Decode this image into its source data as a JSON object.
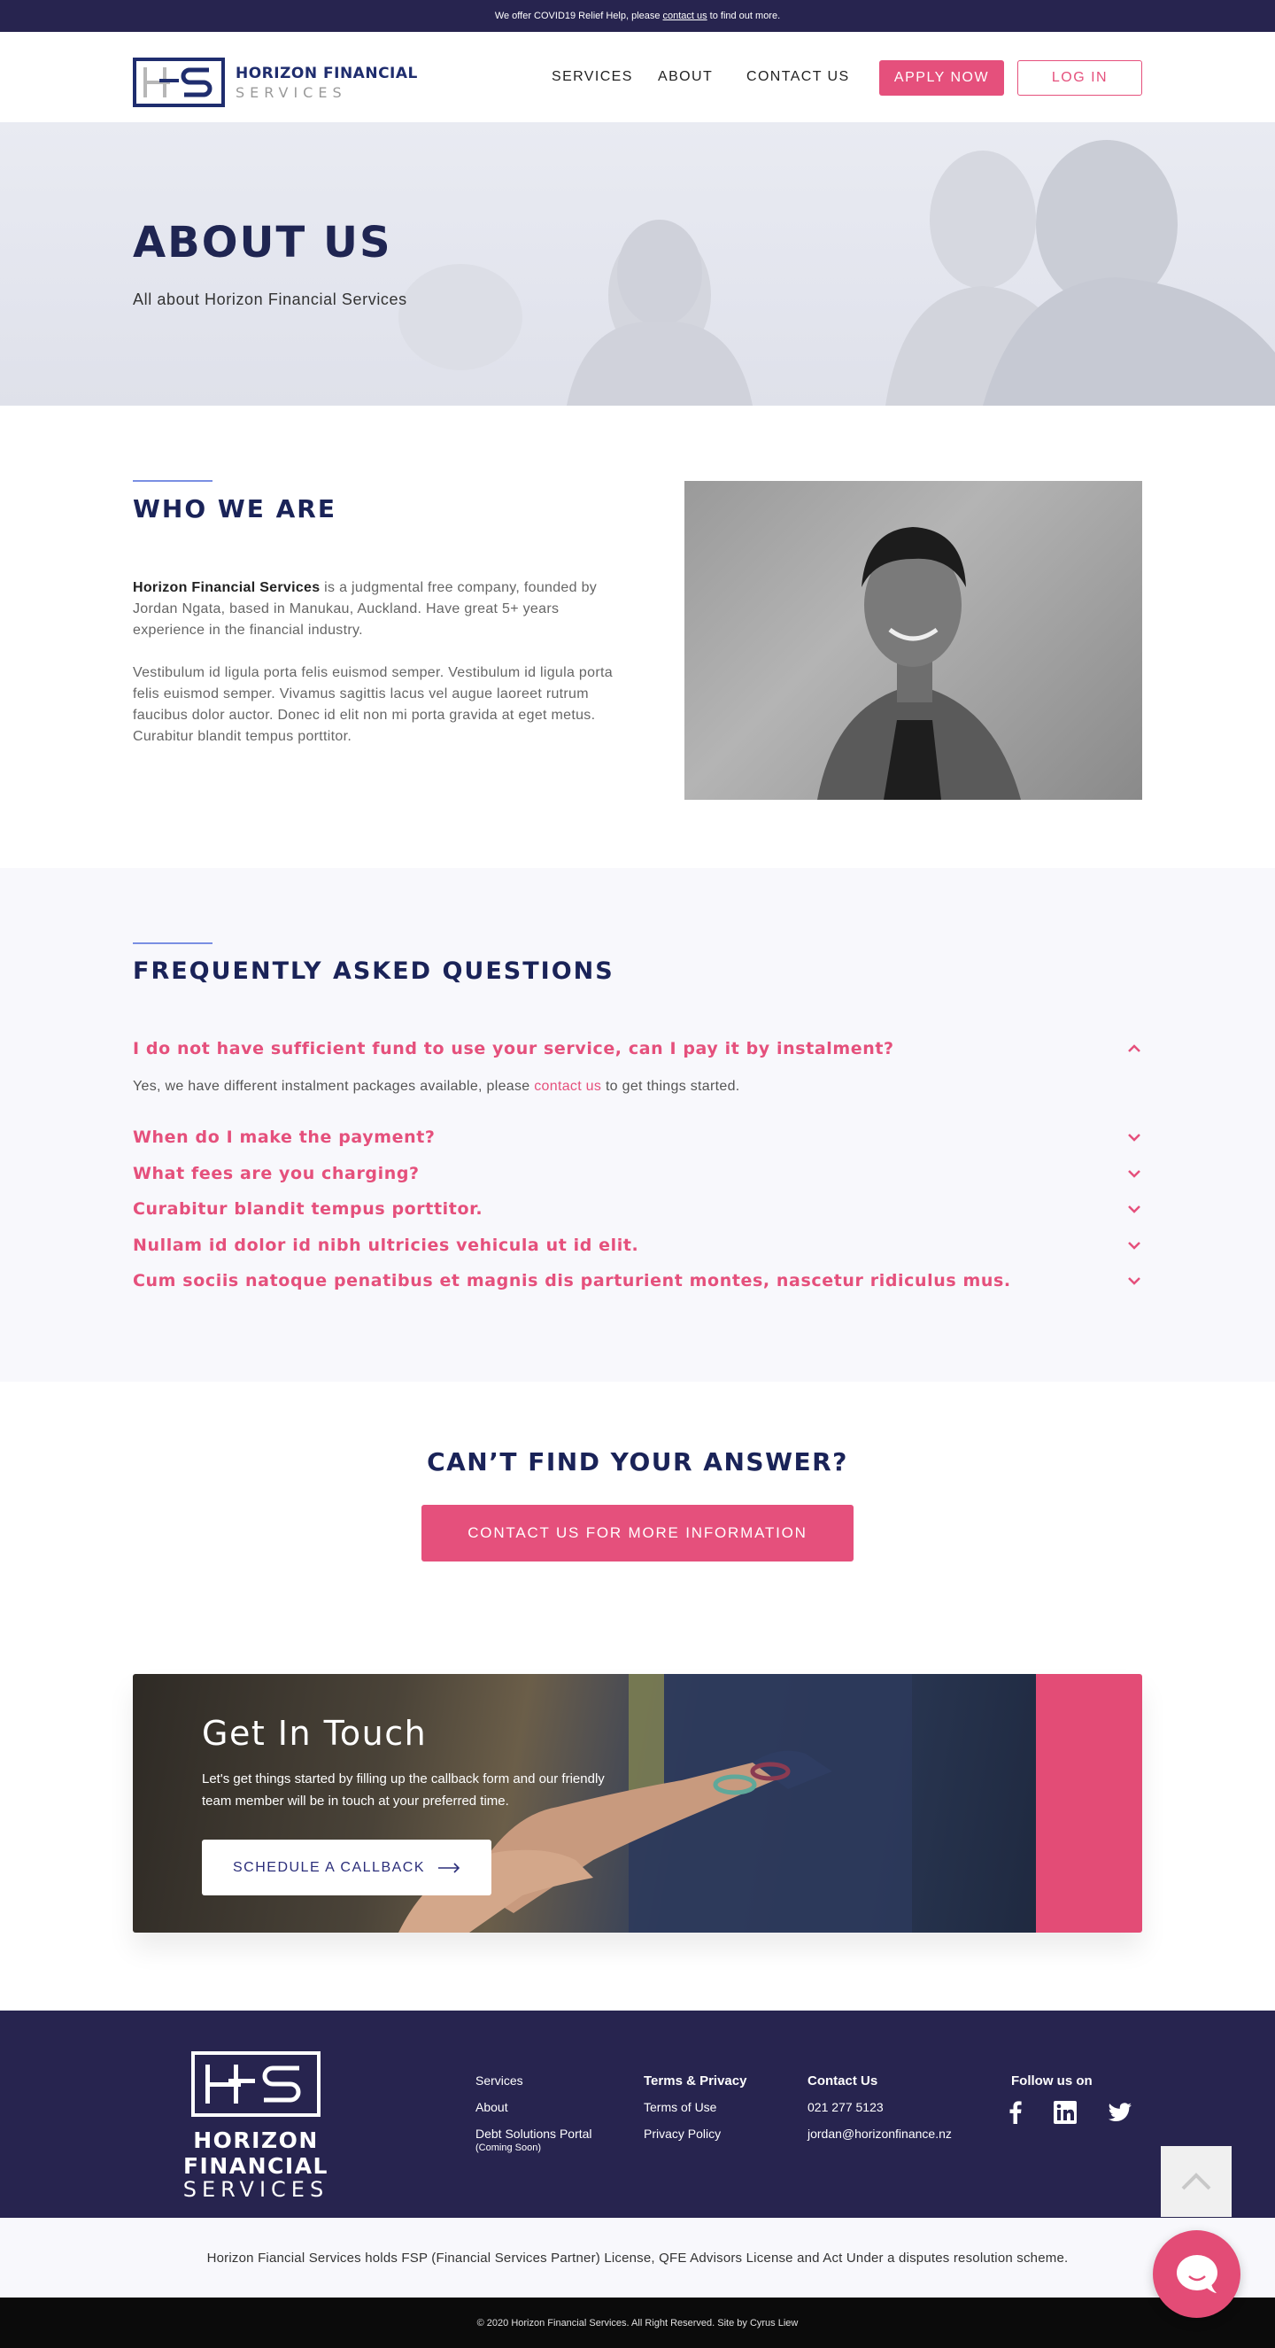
{
  "topbar": {
    "prefix": "We offer COVID19 Relief Help, please",
    "link": "contact us",
    "suffix": "to find out more."
  },
  "header": {
    "logo_line1": "HORIZON FINANCIAL",
    "logo_line2": "SERVICES",
    "nav": [
      "SERVICES",
      "ABOUT",
      "CONTACT US"
    ],
    "apply_label": "APPLY NOW",
    "login_label": "LOG IN"
  },
  "hero": {
    "title": "ABOUT US",
    "subtitle": "All about Horizon Financial Services"
  },
  "who": {
    "title": "WHO WE ARE",
    "company": "Horizon Financial Services",
    "p1_rest": " is a judgmental free company, founded by Jordan Ngata, based in Manukau, Auckland. Have great 5+ years experience in the financial industry.",
    "p2": "Vestibulum id ligula porta felis euismod semper. Vestibulum id ligula porta felis euismod semper. Vivamus sagittis lacus vel augue laoreet rutrum faucibus dolor auctor. Donec id elit non mi porta gravida at eget metus. Curabitur blandit tempus porttitor."
  },
  "faq": {
    "title": "FREQUENTLY ASKED QUESTIONS",
    "open_question": "I do not have sufficient fund to use your service, can I pay it by instalment?",
    "answer_prefix": "Yes, we have different instalment packages available, please",
    "answer_link": "contact us",
    "answer_suffix": "to get things started.",
    "questions": [
      "When do I make the payment?",
      "What fees are you charging?",
      "Curabitur blandit tempus porttitor.",
      "Nullam id dolor id nibh ultricies vehicula ut id elit.",
      "Cum sociis natoque penatibus et magnis dis parturient montes, nascetur ridiculus mus."
    ]
  },
  "cta": {
    "title": "CAN’T FIND YOUR ANSWER?",
    "button": "CONTACT US FOR MORE INFORMATION"
  },
  "get_in_touch": {
    "title": "Get In Touch",
    "text": "Let's get things started by filling up the callback form and our friendly team member will be in touch at your preferred time.",
    "button": "SCHEDULE A CALLBACK"
  },
  "footer": {
    "logo_line1": "HORIZON FINANCIAL",
    "logo_line2": "SERVICES",
    "links": [
      "Services",
      "About",
      "Debt Solutions Portal"
    ],
    "coming_soon": "(Coming Soon)",
    "terms_title": "Terms & Privacy",
    "terms_links": [
      "Terms of Use",
      "Privacy Policy"
    ],
    "contact_title": "Contact Us",
    "phone": "021 277 5123",
    "email": "jordan@horizonfinance.nz",
    "follow_title": "Follow us on",
    "social_icons": [
      "facebook-icon",
      "linkedin-icon",
      "twitter-icon"
    ]
  },
  "license": "Horizon Fiancial Services holds FSP (Financial Services Partner) License, QFE Advisors License and Act Under a disputes resolution scheme.",
  "copyright": "© 2020 Horizon Financial Services. All Right Reserved. Site by Cyrus Liew",
  "colors": {
    "navy": "#27244f",
    "pink": "#e5507c",
    "heading": "#1a2358"
  }
}
